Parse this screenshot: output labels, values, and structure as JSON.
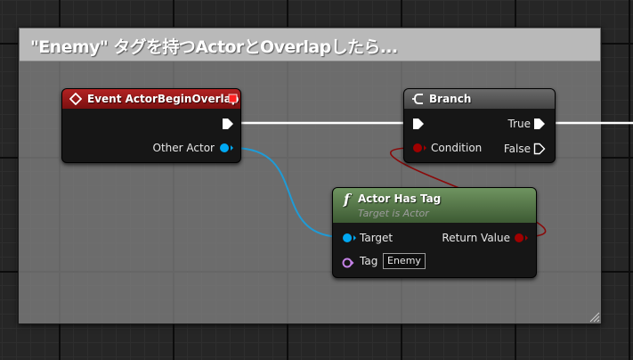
{
  "comment": {
    "title": "\"Enemy\" タグを持つActorとOverlapしたら..."
  },
  "nodes": {
    "event": {
      "title": "Event ActorBeginOverlap",
      "pins": {
        "other_actor": "Other Actor"
      }
    },
    "branch": {
      "title": "Branch",
      "pins": {
        "condition": "Condition",
        "true": "True",
        "false": "False"
      }
    },
    "has_tag": {
      "title": "Actor Has Tag",
      "subtitle": "Target is Actor",
      "icon": "function-icon",
      "icon_glyph": "f",
      "pins": {
        "target": "Target",
        "return_value": "Return Value",
        "tag": "Tag"
      },
      "tag_value": "Enemy"
    }
  },
  "colors": {
    "event_header": "#8c1717",
    "branch_header": "#525252",
    "function_header": "#5a7a4a",
    "object_pin": "#00a8f2",
    "bool_pin": "#a00000",
    "name_pin": "#c482e6",
    "exec_pin": "#ffffff"
  }
}
